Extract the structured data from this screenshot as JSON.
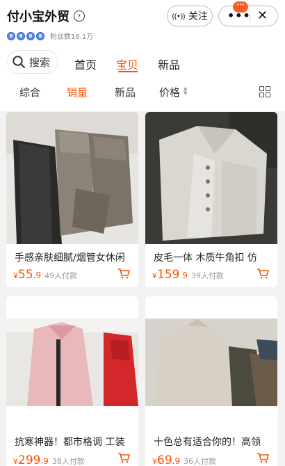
{
  "shop": {
    "name": "付小宝外贸",
    "fans_label": "粉丝数16.1万",
    "rating_gems": 4,
    "follow_label": "关注",
    "message_badge": "···"
  },
  "search": {
    "label": "搜索"
  },
  "tabs": [
    {
      "label": "首页",
      "active": false
    },
    {
      "label": "宝贝",
      "active": true
    },
    {
      "label": "新品",
      "active": false
    }
  ],
  "sort": {
    "items": [
      {
        "label": "综合",
        "active": false
      },
      {
        "label": "销量",
        "active": true
      },
      {
        "label": "新品",
        "active": false
      },
      {
        "label": "价格",
        "active": false
      }
    ]
  },
  "colors": {
    "accent": "#ff5000",
    "badge": "#ff5e1f",
    "background": "#f2f2f2"
  },
  "products": [
    {
      "title": "手感亲肤细腻/烟管女休闲",
      "currency": "¥",
      "price_int": "55",
      "price_dec": ".9",
      "sold": "49人付款",
      "image": "folded-trousers"
    },
    {
      "title": "皮毛一体 木质牛角扣 仿",
      "currency": "¥",
      "price_int": "159",
      "price_dec": ".9",
      "sold": "39人付款",
      "image": "fur-coat"
    },
    {
      "title": "抗寒神器！都市格调 工装",
      "currency": "¥",
      "price_int": "299",
      "price_dec": ".9",
      "sold": "38人付款",
      "image": "pink-parka"
    },
    {
      "title": "十色总有适合你的！高领",
      "currency": "¥",
      "price_int": "69",
      "price_dec": ".9",
      "sold": "36人付款",
      "image": "turtleneck-sweater"
    }
  ]
}
